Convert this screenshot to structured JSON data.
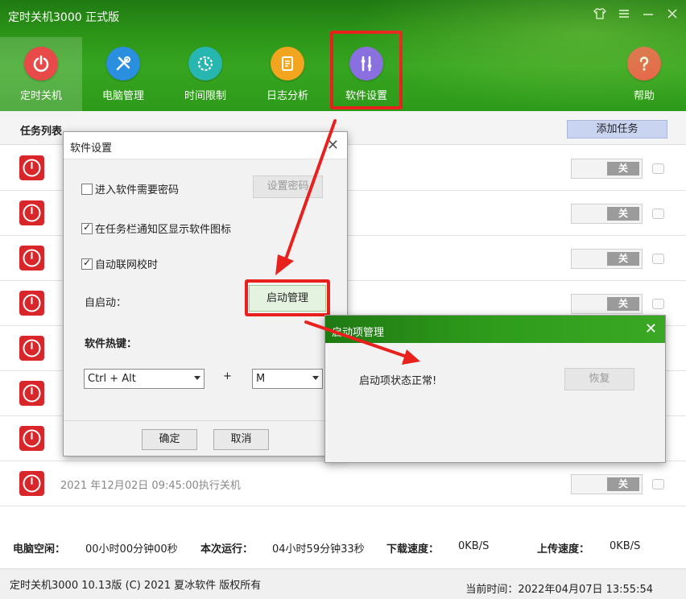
{
  "window": {
    "title": "定时关机3000 正式版",
    "controls": [
      "shirt-icon",
      "menu-icon",
      "minimize-icon",
      "close-icon"
    ]
  },
  "nav": {
    "items": [
      {
        "label": "定时关机",
        "icon": "power-icon",
        "color": "#e84a4a",
        "active": true
      },
      {
        "label": "电脑管理",
        "icon": "tools-icon",
        "color": "#2b8fe0",
        "active": false
      },
      {
        "label": "时间限制",
        "icon": "timer-icon",
        "color": "#28b6b0",
        "active": false
      },
      {
        "label": "日志分析",
        "icon": "log-icon",
        "color": "#f2a51e",
        "active": false
      },
      {
        "label": "软件设置",
        "icon": "settings-icon",
        "color": "#8a6fe0",
        "active": false
      },
      {
        "label": "帮助",
        "icon": "help-icon",
        "color": "#ef5a4a",
        "active": false
      }
    ]
  },
  "task_list": {
    "title": "任务列表",
    "add_button": "添加任务",
    "rows": [
      {
        "text": "",
        "switch": "关"
      },
      {
        "text": "",
        "switch": "关"
      },
      {
        "text": "",
        "switch": "关"
      },
      {
        "text": "",
        "switch": "关"
      },
      {
        "text": "",
        "switch": "关"
      },
      {
        "text": "",
        "switch": "关"
      },
      {
        "text": "",
        "switch": "关"
      },
      {
        "text": "2021 年12月02日 09:45:00执行关机",
        "switch": "关"
      }
    ]
  },
  "status": {
    "idle_label": "电脑空闲：",
    "idle_value": "00小时00分钟00秒",
    "run_label": "本次运行：",
    "run_value": "04小时59分钟33秒",
    "down_label": "下载速度：",
    "down_value": "0KB/S",
    "up_label": "上传速度：",
    "up_value": "0KB/S"
  },
  "footer": {
    "copyright": "定时关机3000 10.13版 (C) 2021  夏冰软件 版权所有",
    "current_time": "当前时间：2022年04月07日 13:55:54"
  },
  "settings_dialog": {
    "title": "软件设置",
    "require_password_label": "进入软件需要密码",
    "require_password_checked": false,
    "set_password_button": "设置密码",
    "tray_icon_label": "在任务栏通知区显示软件图标",
    "tray_icon_checked": true,
    "auto_sync_label": "自动联网校时",
    "auto_sync_checked": true,
    "autostart_label": "自启动：",
    "startup_manage_button": "启动管理",
    "hotkey_label": "软件热键：",
    "hotkey_modifier": "Ctrl + Alt",
    "hotkey_plus": "+",
    "hotkey_key": "M",
    "ok_button": "确定",
    "cancel_button": "取消"
  },
  "startup_dialog": {
    "title": "启动项管理",
    "status_text": "启动项状态正常!",
    "restore_button": "恢复"
  },
  "colors": {
    "header_green": "#2c9418",
    "annotation_red": "#e8201e",
    "task_power_red": "#d8262a"
  }
}
